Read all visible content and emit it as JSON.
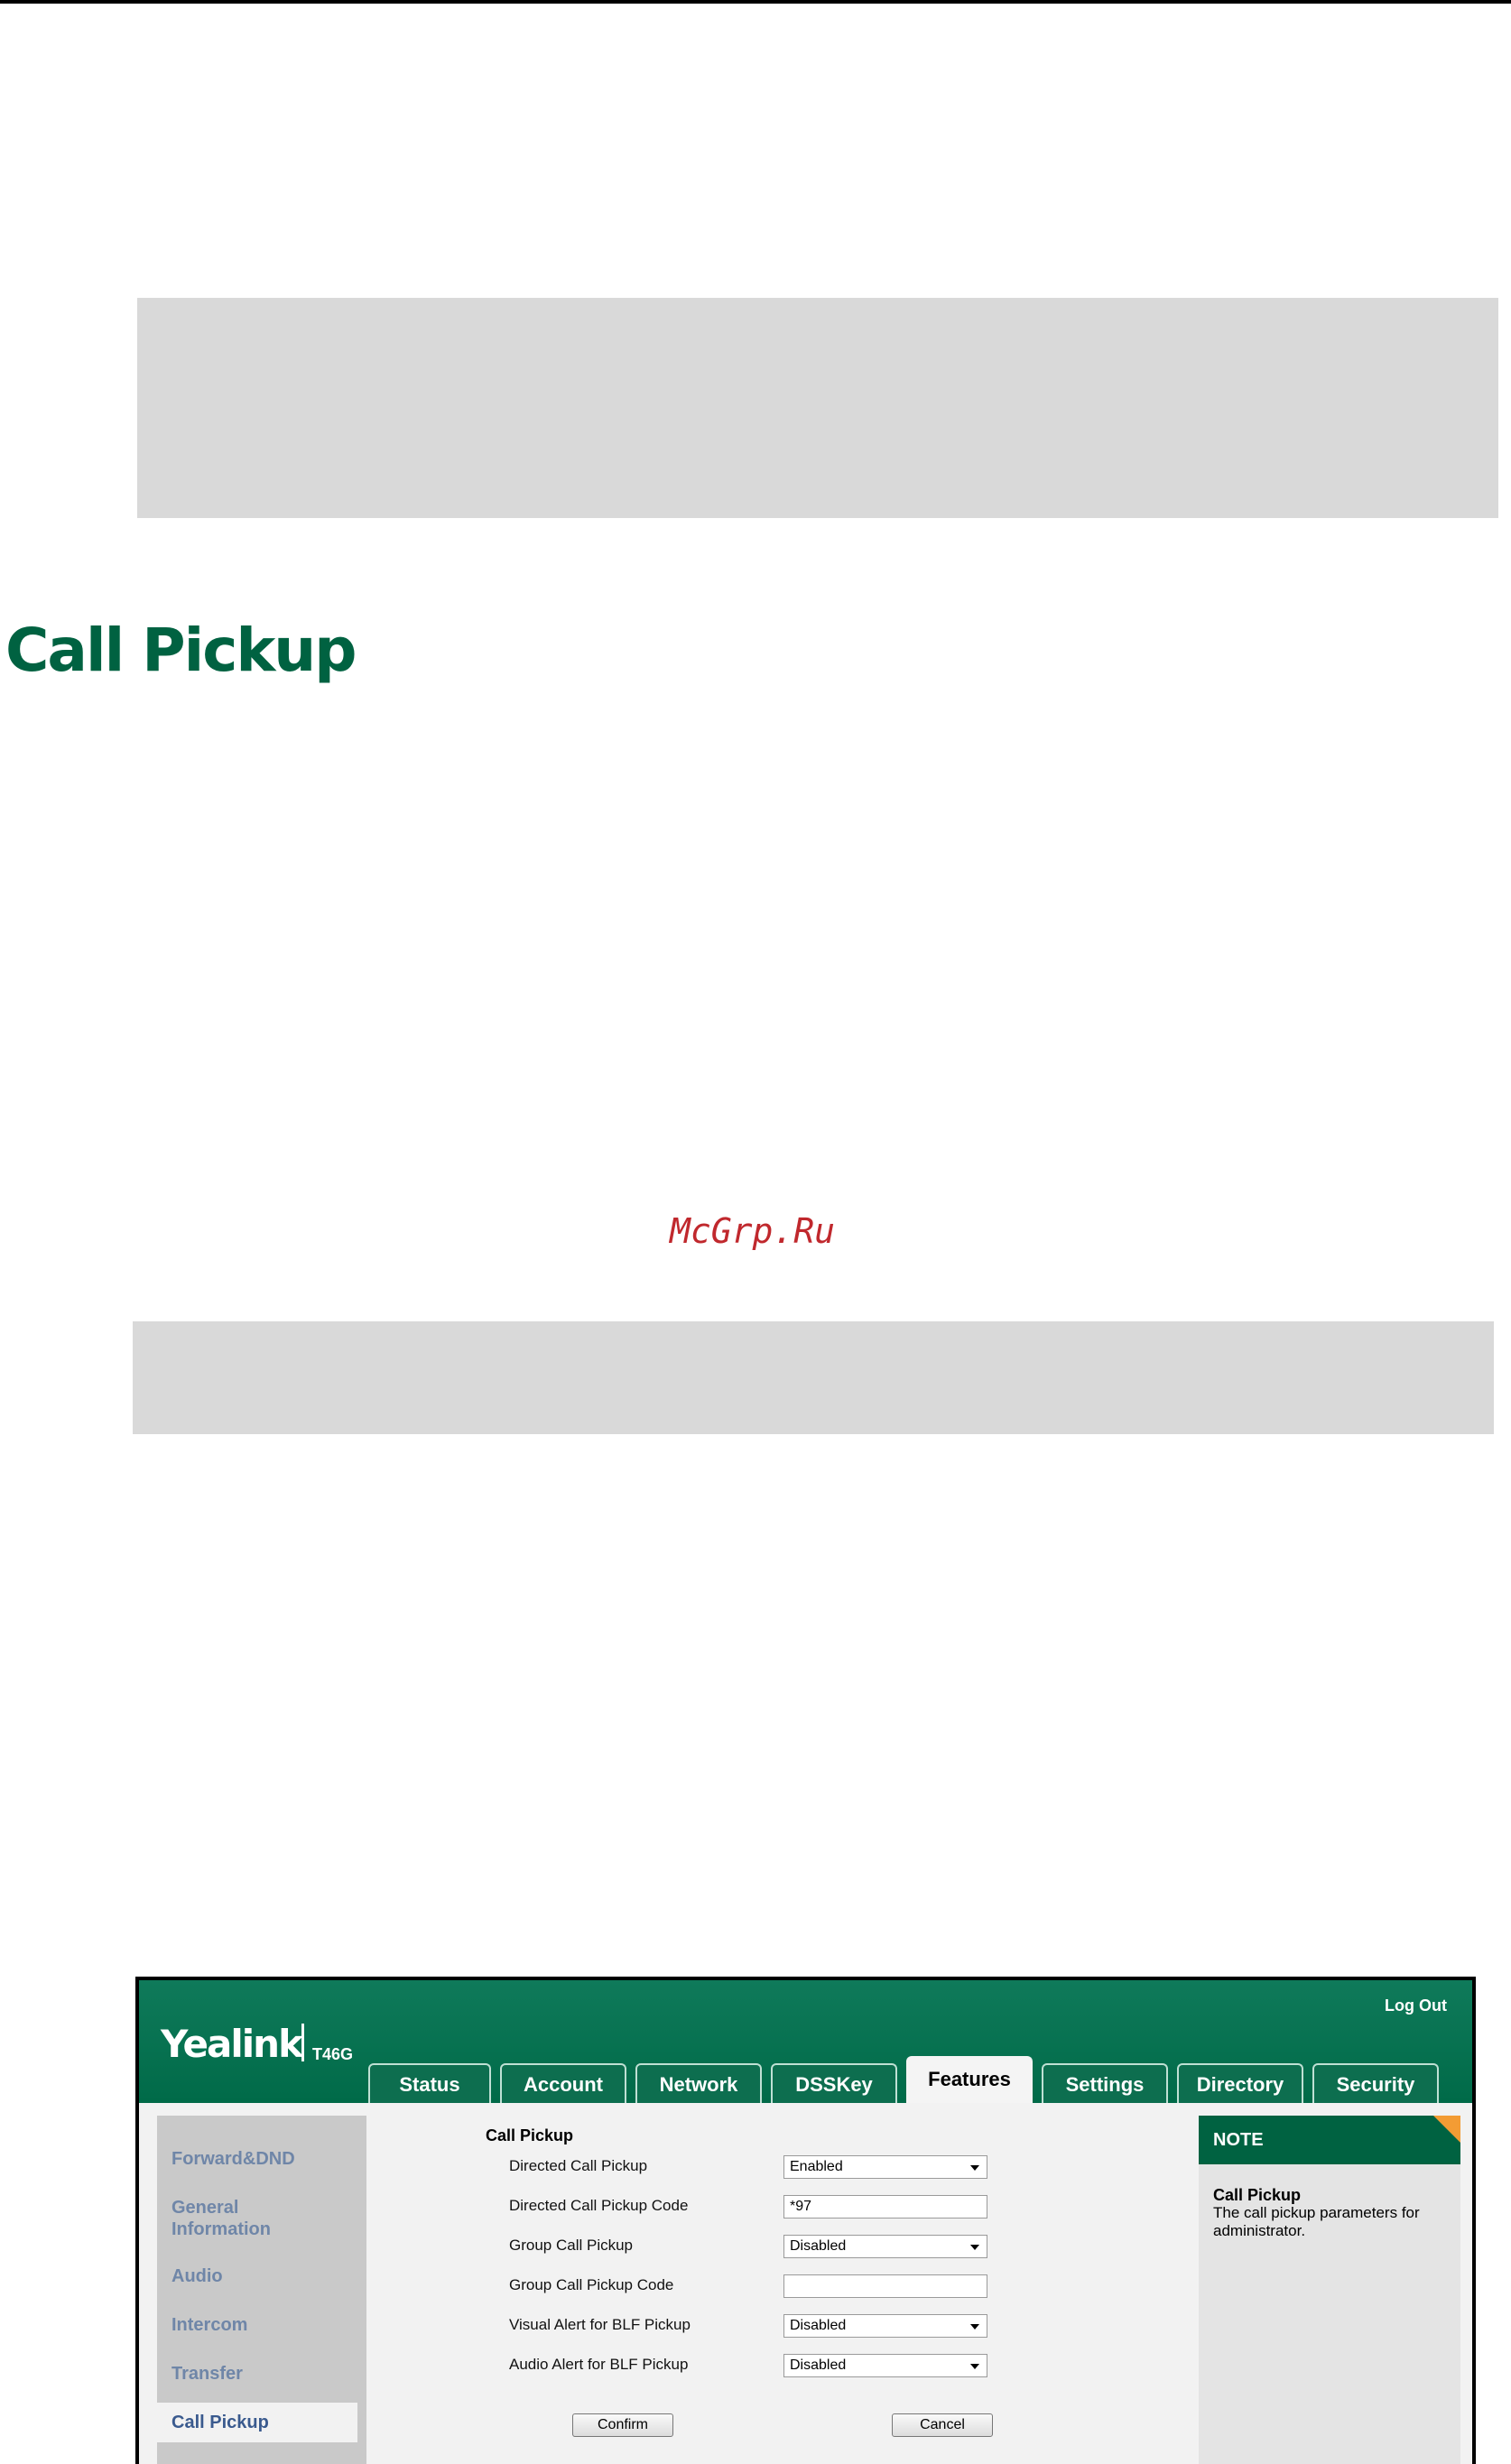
{
  "section": {
    "heading": "Call Pickup"
  },
  "watermark": "McGrp.Ru",
  "web_ui": {
    "logo": "Yealink",
    "model": "T46G",
    "logout": "Log Out",
    "tabs": [
      "Status",
      "Account",
      "Network",
      "DSSKey",
      "Features",
      "Settings",
      "Directory",
      "Security"
    ],
    "active_tab": "Features",
    "sidebar": [
      "Forward&DND",
      "General Information",
      "Audio",
      "Intercom",
      "Transfer",
      "Call Pickup"
    ],
    "active_sidebar": "Call Pickup",
    "form": {
      "title": "Call Pickup",
      "fields": [
        {
          "label": "Directed Call Pickup",
          "value": "Enabled",
          "type": "select"
        },
        {
          "label": "Directed Call Pickup Code",
          "value": "*97",
          "type": "text"
        },
        {
          "label": "Group Call Pickup",
          "value": "Disabled",
          "type": "select"
        },
        {
          "label": "Group Call Pickup Code",
          "value": "",
          "type": "text"
        },
        {
          "label": "Visual Alert for BLF Pickup",
          "value": "Disabled",
          "type": "select"
        },
        {
          "label": "Audio Alert for BLF Pickup",
          "value": "Disabled",
          "type": "select"
        }
      ],
      "confirm": "Confirm",
      "cancel": "Cancel"
    },
    "note": {
      "header": "NOTE",
      "title": "Call Pickup",
      "text": "The call pickup parameters for administrator."
    }
  }
}
